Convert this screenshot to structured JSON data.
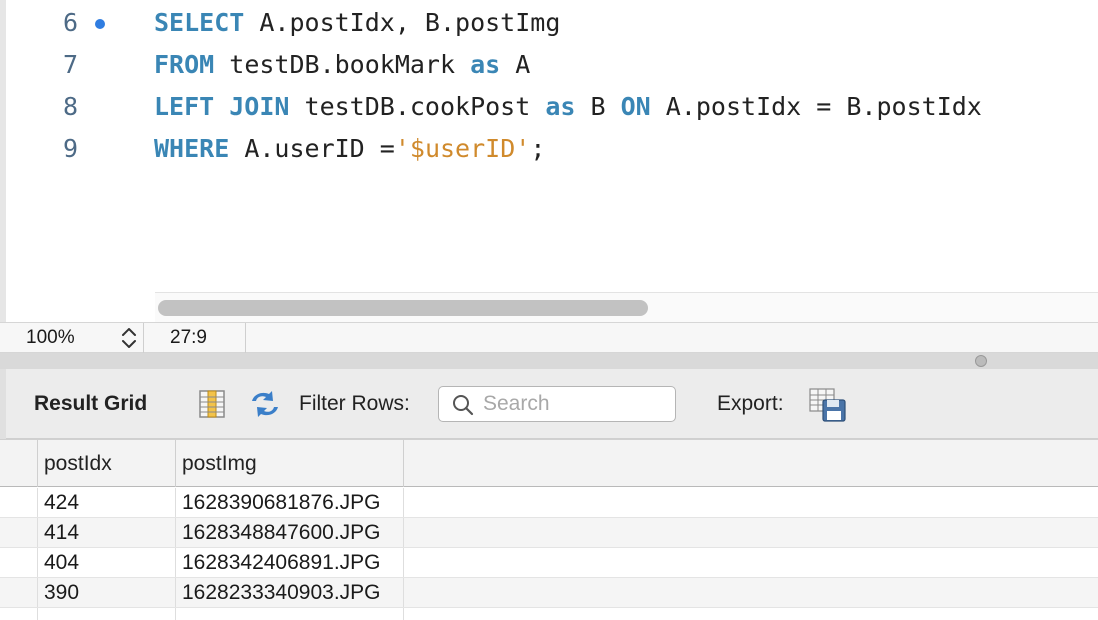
{
  "editor": {
    "lines": [
      {
        "number": "6",
        "has_marker": true,
        "tokens": [
          {
            "text": "SELECT",
            "type": "kw"
          },
          {
            "text": " A.postIdx, B.postImg",
            "type": "plain"
          }
        ]
      },
      {
        "number": "7",
        "has_marker": false,
        "tokens": [
          {
            "text": "FROM",
            "type": "kw"
          },
          {
            "text": " testDB.bookMark ",
            "type": "plain"
          },
          {
            "text": "as",
            "type": "kw"
          },
          {
            "text": " A",
            "type": "plain"
          }
        ]
      },
      {
        "number": "8",
        "has_marker": false,
        "tokens": [
          {
            "text": "LEFT JOIN",
            "type": "kw"
          },
          {
            "text": " testDB.cookPost ",
            "type": "plain"
          },
          {
            "text": "as",
            "type": "kw"
          },
          {
            "text": " B ",
            "type": "plain"
          },
          {
            "text": "ON",
            "type": "kw"
          },
          {
            "text": " A.postIdx = B.postIdx",
            "type": "plain"
          }
        ]
      },
      {
        "number": "9",
        "has_marker": false,
        "tokens": [
          {
            "text": "WHERE",
            "type": "kw"
          },
          {
            "text": " A.userID =",
            "type": "plain"
          },
          {
            "text": "'$userID'",
            "type": "str"
          },
          {
            "text": ";",
            "type": "plain"
          }
        ]
      }
    ],
    "colors": {
      "keyword": "#3a86b5",
      "string": "#d08a2c",
      "marker": "#2f7de1"
    }
  },
  "status_bar": {
    "zoom": "100%",
    "cursor_position": "27:9"
  },
  "result_toolbar": {
    "title": "Result Grid",
    "filter_label": "Filter Rows:",
    "search_placeholder": "Search",
    "export_label": "Export:",
    "icons": [
      "grid-columns-icon",
      "refresh-icon",
      "search-icon",
      "export-icon"
    ]
  },
  "result_grid": {
    "columns": [
      "postIdx",
      "postImg"
    ],
    "rows": [
      [
        "424",
        "1628390681876.JPG"
      ],
      [
        "414",
        "1628348847600.JPG"
      ],
      [
        "404",
        "1628342406891.JPG"
      ],
      [
        "390",
        "1628233340903.JPG"
      ]
    ]
  }
}
